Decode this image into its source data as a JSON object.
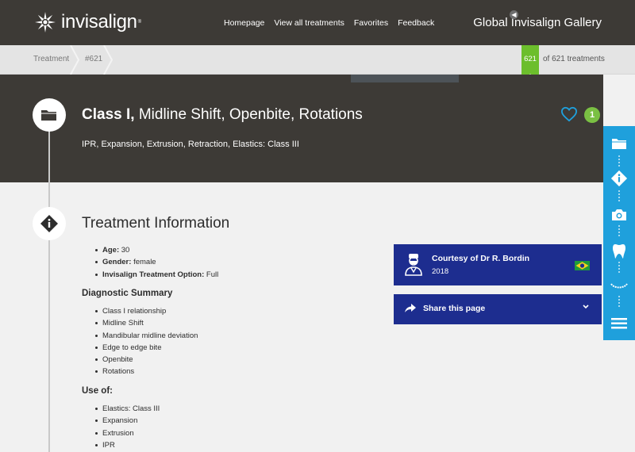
{
  "header": {
    "logo_text": "invisalign",
    "logo_reg": "®",
    "nav": [
      "Homepage",
      "View all treatments",
      "Favorites",
      "Feedback"
    ],
    "gallery_title": "Global Invisalign Gallery"
  },
  "breadcrumb": {
    "items": [
      "Treatment",
      "#621"
    ],
    "current_number": "621",
    "count_text": "of 621 treatments"
  },
  "case": {
    "title_bold": "Class I,",
    "title_rest": " Midline Shift, Openbite, Rotations",
    "subtitle": "IPR, Expansion, Extrusion, Retraction, Elastics: Class III",
    "favorite_count": "1"
  },
  "treatment_info": {
    "heading": "Treatment Information",
    "details": [
      {
        "label": "Age:",
        "value": " 30"
      },
      {
        "label": "Gender:",
        "value": " female"
      },
      {
        "label": "Invisalign Treatment Option:",
        "value": " Full"
      }
    ],
    "diagnostic_heading": "Diagnostic Summary",
    "diagnostic_items": [
      "Class I relationship",
      "Midline Shift",
      "Mandibular midline deviation",
      "Edge to edge bite",
      "Openbite",
      "Rotations"
    ],
    "use_heading": "Use of:",
    "use_items": [
      "Elastics: Class III",
      "Expansion",
      "Extrusion",
      "IPR"
    ]
  },
  "courtesy": {
    "name": "Courtesy of Dr R. Bordin",
    "year": "2018"
  },
  "share": {
    "label": "Share this page"
  },
  "sidebar": {
    "icons": [
      "folder-icon",
      "info-icon",
      "camera-icon",
      "tooth-icon",
      "teeth-icon",
      "menu-icon"
    ]
  },
  "colors": {
    "dark_band": "#3d3a36",
    "accent_green": "#6cbe2c",
    "panel_blue": "#1d2d8f",
    "sidebar_blue": "#1fa0dc",
    "heart_blue": "#1fa0dc"
  }
}
